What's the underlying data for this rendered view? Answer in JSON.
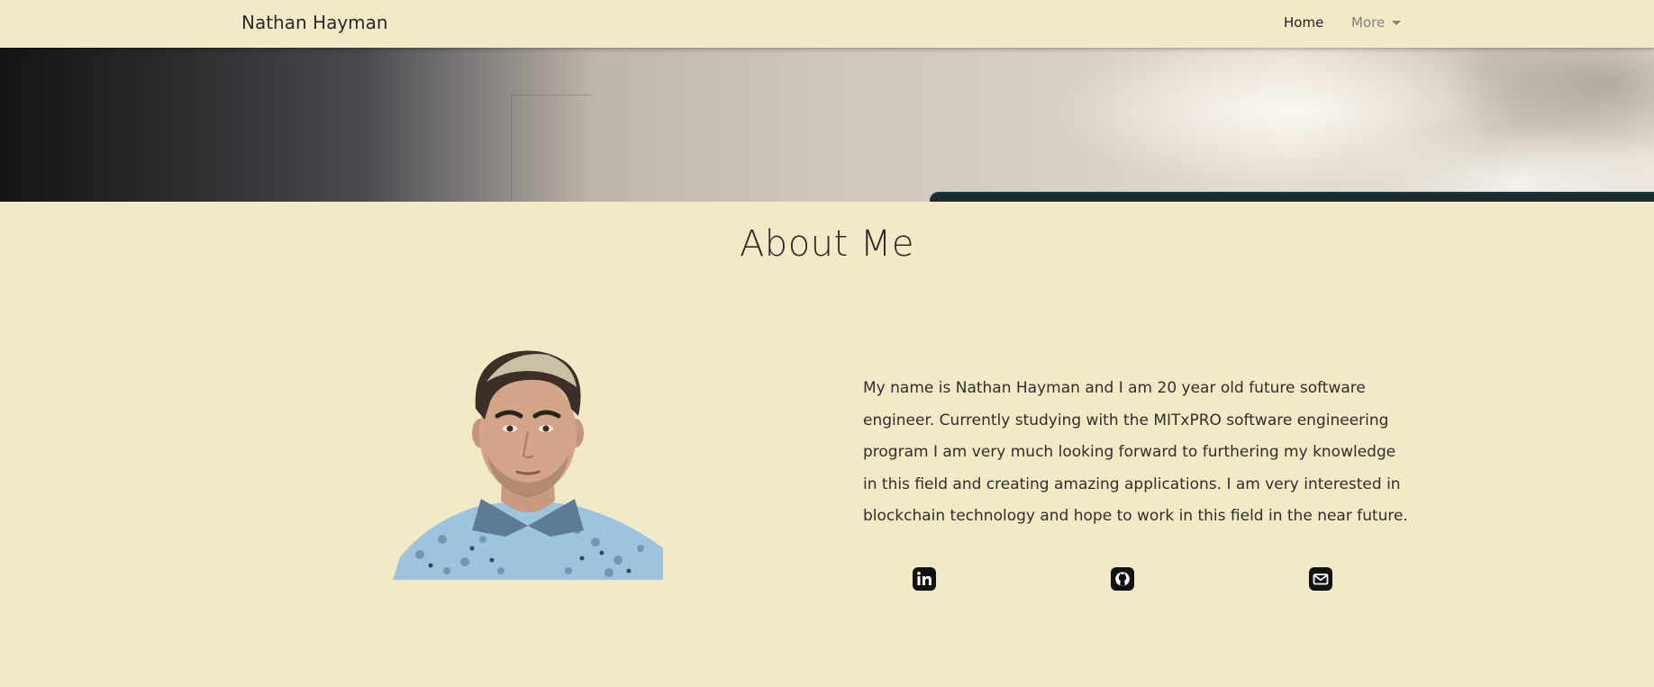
{
  "navbar": {
    "brand": "Nathan Hayman",
    "home_label": "Home",
    "more_label": "More"
  },
  "hero": {
    "image_name": "desk-background-image"
  },
  "about": {
    "title": "About Me",
    "bio": "My name is Nathan Hayman and I am 20 year old future software engineer. Currently studying with the MITxPRO software engineering program I am very much looking forward to furthering my knowledge in this field and creating amazing applications. I am very interested in blockchain technology and hope to work in this field in the near future.",
    "profile_image": "profile-photo"
  },
  "social": {
    "icons": [
      "linkedin-icon",
      "github-icon",
      "mail-icon"
    ]
  },
  "colors": {
    "page_background": "#f2eac7",
    "text": "#222222",
    "nav_muted": "#808080"
  }
}
